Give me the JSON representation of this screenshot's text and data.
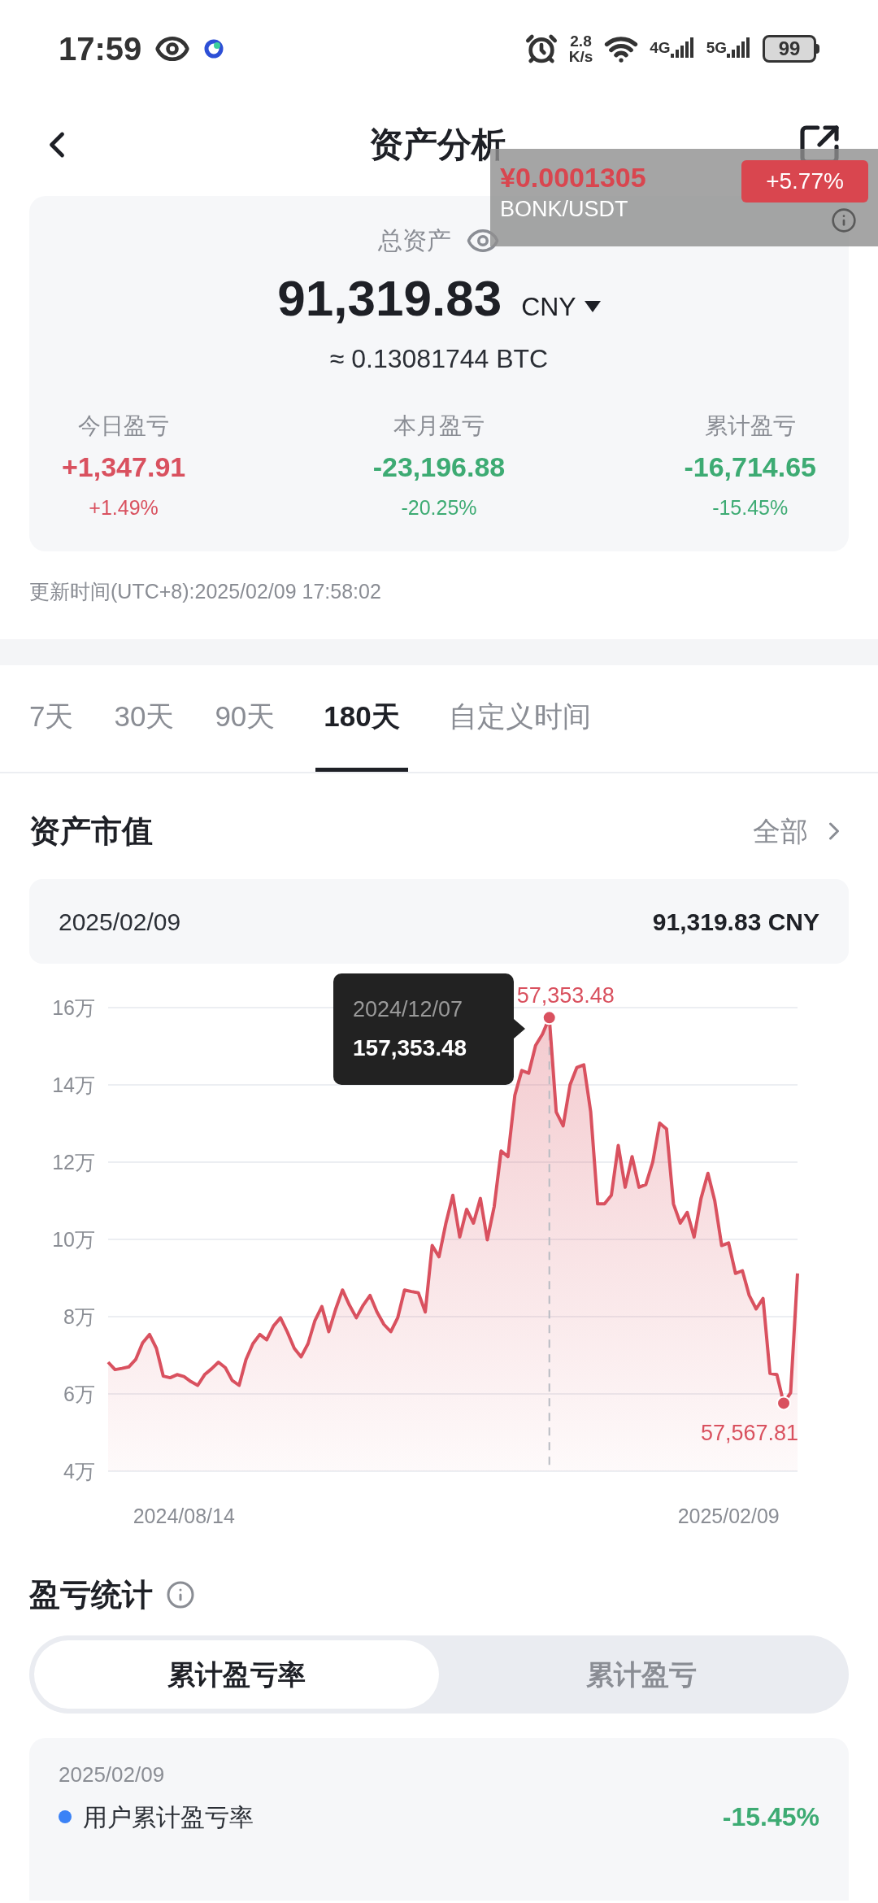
{
  "status_bar": {
    "time": "17:59",
    "speed_value": "2.8",
    "speed_unit": "K/s",
    "network_1": "4G",
    "network_2": "5G",
    "battery": "99"
  },
  "header": {
    "title": "资产分析"
  },
  "ticker_overlay": {
    "price": "¥0.0001305",
    "pair": "BONK/USDT",
    "change": "+5.77%"
  },
  "summary": {
    "label": "总资产",
    "amount": "91,319.83",
    "currency": "CNY",
    "btc": "≈ 0.13081744 BTC",
    "stats": [
      {
        "label": "今日盈亏",
        "value": "+1,347.91",
        "pct": "+1.49%",
        "color": "#d9515f"
      },
      {
        "label": "本月盈亏",
        "value": "-23,196.88",
        "pct": "-20.25%",
        "color": "#3dab73"
      },
      {
        "label": "累计盈亏",
        "value": "-16,714.65",
        "pct": "-15.45%",
        "color": "#3dab73"
      }
    ],
    "updated": "更新时间(UTC+8):2025/02/09 17:58:02"
  },
  "tabs": [
    {
      "label": "7天",
      "selected": false
    },
    {
      "label": "30天",
      "selected": false
    },
    {
      "label": "90天",
      "selected": false
    },
    {
      "label": "180天",
      "selected": true
    },
    {
      "label": "自定义时间",
      "selected": false
    }
  ],
  "market_value": {
    "title": "资产市值",
    "link": "全部",
    "selected_date": "2025/02/09",
    "selected_value": "91,319.83 CNY",
    "tooltip": {
      "date": "2024/12/07",
      "value": "157,353.48"
    },
    "chart_data": {
      "type": "area",
      "grid": true,
      "ylim": [
        4,
        16
      ],
      "categories": [
        null,
        null,
        null,
        null,
        null,
        null,
        null,
        null,
        null,
        null,
        null,
        "2024/08/14",
        null,
        null,
        null,
        null,
        null,
        null,
        null,
        null,
        null,
        null,
        null,
        null,
        null,
        null,
        null,
        null,
        null,
        null,
        null,
        null,
        null,
        null,
        null,
        null,
        null,
        null,
        null,
        null,
        null,
        null,
        null,
        null,
        null,
        null,
        null,
        null,
        null,
        null,
        null,
        null,
        null,
        null,
        null,
        null,
        null,
        null,
        null,
        null,
        null,
        null,
        null,
        null,
        null,
        null,
        null,
        null,
        null,
        null,
        null,
        null,
        null,
        null,
        null,
        null,
        null,
        null,
        null,
        null,
        null,
        null,
        null,
        null,
        null,
        null,
        null,
        null,
        null,
        null,
        "2025/02/09",
        null,
        null,
        null,
        null,
        null,
        null,
        null,
        null,
        null,
        null
      ],
      "yticks": [
        {
          "value": 4,
          "label": "4万"
        },
        {
          "value": 6,
          "label": "6万"
        },
        {
          "value": 8,
          "label": "8万"
        },
        {
          "value": 10,
          "label": "10万"
        },
        {
          "value": 12,
          "label": "12万"
        },
        {
          "value": 14,
          "label": "14万"
        },
        {
          "value": 16,
          "label": "16万"
        }
      ],
      "series": [
        {
          "color": "#d9515f",
          "values": [
            6.82,
            6.63,
            6.66,
            6.7,
            6.89,
            7.32,
            7.54,
            7.18,
            6.46,
            6.42,
            6.5,
            6.45,
            6.32,
            6.22,
            6.5,
            6.65,
            6.82,
            6.68,
            6.35,
            6.22,
            6.89,
            7.3,
            7.54,
            7.4,
            7.76,
            7.97,
            7.6,
            7.18,
            6.96,
            7.3,
            7.9,
            8.26,
            7.61,
            8.19,
            8.69,
            8.3,
            7.97,
            8.3,
            8.55,
            8.12,
            7.8,
            7.61,
            7.97,
            8.69,
            8.65,
            8.62,
            8.12,
            9.84,
            9.55,
            10.42,
            11.14,
            10.06,
            10.78,
            10.42,
            11.06,
            9.99,
            10.85,
            12.29,
            12.14,
            13.73,
            14.37,
            14.3,
            15.02,
            15.31,
            15.74,
            13.3,
            12.94,
            14,
            14.45,
            14.52,
            13.3,
            10.92,
            10.92,
            11.14,
            12.43,
            11.35,
            12.14,
            11.35,
            11.42,
            12,
            13.01,
            12.86,
            10.92,
            10.42,
            10.7,
            10.06,
            11.06,
            11.71,
            11,
            9.84,
            9.91,
            9.12,
            9.19,
            8.55,
            8.2,
            8.47,
            6.53,
            6.5,
            5.76,
            6.03,
            9.12
          ]
        }
      ],
      "annotations": [
        "57,353.48",
        "57,567.81"
      ]
    }
  },
  "pnl": {
    "title": "盈亏统计",
    "segments": [
      {
        "label": "累计盈亏率",
        "selected": true
      },
      {
        "label": "累计盈亏",
        "selected": false
      }
    ],
    "date": "2025/02/09",
    "rows": [
      {
        "label": "用户累计盈亏率",
        "value": "-15.45%",
        "color": "#3b82f6"
      }
    ]
  }
}
